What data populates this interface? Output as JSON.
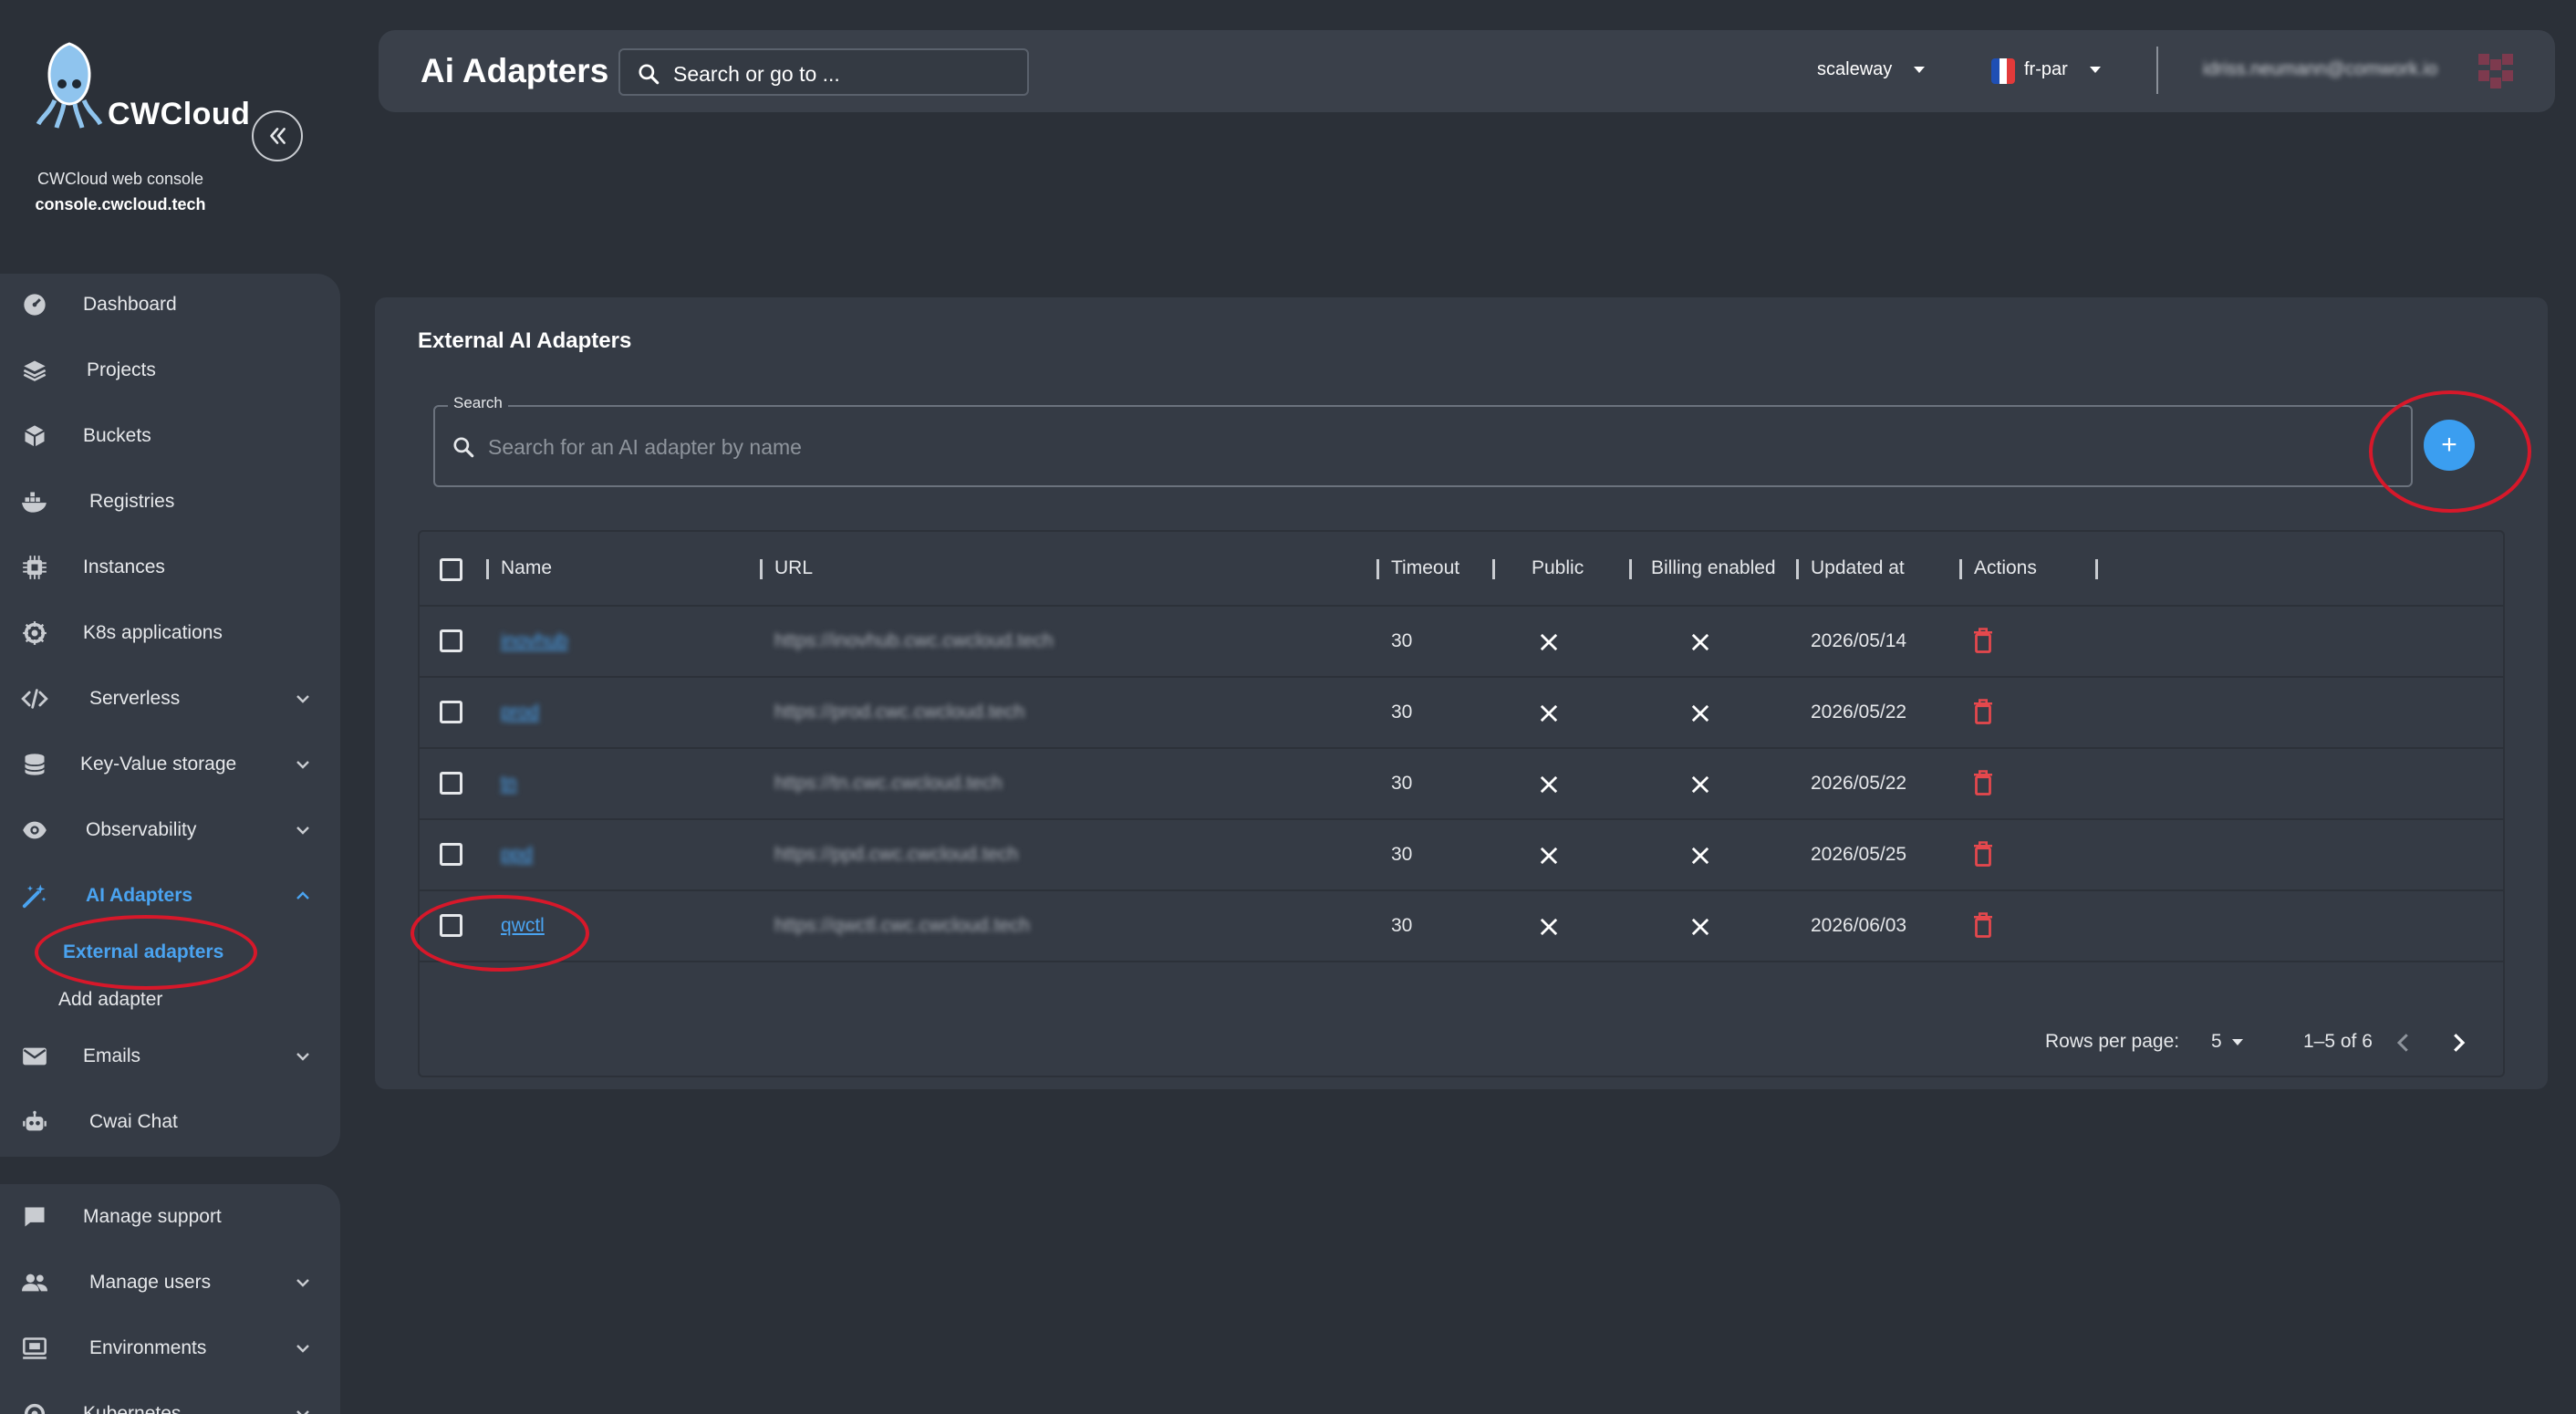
{
  "brand": {
    "logo_text": "CWCloud",
    "subtitle": "CWCloud web console",
    "url": "console.cwcloud.tech"
  },
  "sidebar": {
    "items": [
      {
        "label": "Dashboard",
        "icon": "dashboard-icon"
      },
      {
        "label": "Projects",
        "icon": "layers-icon"
      },
      {
        "label": "Buckets",
        "icon": "box-icon"
      },
      {
        "label": "Registries",
        "icon": "docker-icon"
      },
      {
        "label": "Instances",
        "icon": "chip-icon"
      },
      {
        "label": "K8s applications",
        "icon": "helm-icon"
      },
      {
        "label": "Serverless",
        "icon": "code-icon"
      },
      {
        "label": "Key-Value storage",
        "icon": "database-icon"
      },
      {
        "label": "Observability",
        "icon": "eye-icon"
      },
      {
        "label": "AI Adapters",
        "icon": "magic-wand-icon"
      },
      {
        "label": "Emails",
        "icon": "mail-icon"
      },
      {
        "label": "Cwai Chat",
        "icon": "robot-icon"
      }
    ],
    "sub_items": [
      "External adapters",
      "Add adapter"
    ],
    "admin_items": [
      {
        "label": "Manage support",
        "icon": "chat-icon"
      },
      {
        "label": "Manage users",
        "icon": "users-icon"
      },
      {
        "label": "Environments",
        "icon": "monitor-icon"
      },
      {
        "label": "Kubernetes",
        "icon": "helm-icon"
      }
    ]
  },
  "topbar": {
    "title": "Ai Adapters",
    "search_text": "Search or go to ...",
    "provider": "scaleway",
    "region": "fr-par",
    "user_email": "idriss.neumann@comwork.io"
  },
  "card": {
    "title": "External AI Adapters",
    "search_label": "Search",
    "search_placeholder": "Search for an AI adapter by name",
    "add_button": "+"
  },
  "table": {
    "columns": [
      "Name",
      "URL",
      "Timeout",
      "Public",
      "Billing enabled",
      "Updated at",
      "Actions"
    ],
    "rows": [
      {
        "name": "inovhub",
        "url": "https://inovhub.cwc.cwcloud.tech",
        "timeout": "30",
        "public": false,
        "billing": false,
        "updated": "2026/05/14"
      },
      {
        "name": "prod",
        "url": "https://prod.cwc.cwcloud.tech",
        "timeout": "30",
        "public": false,
        "billing": false,
        "updated": "2026/05/22"
      },
      {
        "name": "tn",
        "url": "https://tn.cwc.cwcloud.tech",
        "timeout": "30",
        "public": false,
        "billing": false,
        "updated": "2026/05/22"
      },
      {
        "name": "ppd",
        "url": "https://ppd.cwc.cwcloud.tech",
        "timeout": "30",
        "public": false,
        "billing": false,
        "updated": "2026/05/25"
      },
      {
        "name": "qwctl",
        "url": "https://qwctl.cwc.cwcloud.tech",
        "timeout": "30",
        "public": false,
        "billing": false,
        "updated": "2026/06/03"
      }
    ],
    "rows_per_page_label": "Rows per page:",
    "rows_per_page": "5",
    "range": "1–5 of 6"
  },
  "colors": {
    "background": "#2b3038",
    "panel": "#353b45",
    "accent": "#4aa3f0",
    "add_button": "#3b9ef0",
    "danger": "#e5484d",
    "highlight_ring": "#d7182a"
  }
}
